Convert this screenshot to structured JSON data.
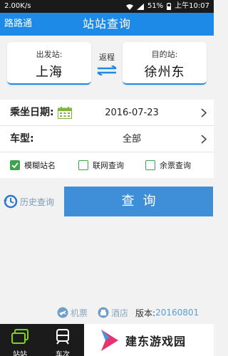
{
  "status_bar": {
    "speed": "2.00K/s",
    "battery": "51%",
    "time": "上午10:07"
  },
  "header": {
    "app_name": "路路通",
    "title": "站站查询"
  },
  "stations": {
    "from_label": "出发站:",
    "from_value": "上海",
    "swap_label": "返程",
    "to_label": "目的站:",
    "to_value": "徐州东"
  },
  "form": {
    "date_label": "乘坐日期:",
    "date_value": "2016-07-23",
    "type_label": "车型:",
    "type_value": "全部"
  },
  "options": [
    {
      "label": "模糊站名",
      "checked": true
    },
    {
      "label": "联网查询",
      "checked": false
    },
    {
      "label": "余票查询",
      "checked": false
    }
  ],
  "history_label": "历史查询",
  "query_label": "查询",
  "links": {
    "flight": "机票",
    "hotel": "酒店",
    "version_label": "版本:",
    "version_value": "20160801"
  },
  "bottom_nav": [
    {
      "label": "站站"
    },
    {
      "label": "车次"
    }
  ],
  "watermark": "建东游戏园",
  "colors": {
    "primary": "#1e8ae8",
    "button": "#3f8fd8",
    "check": "#3aa54a"
  }
}
